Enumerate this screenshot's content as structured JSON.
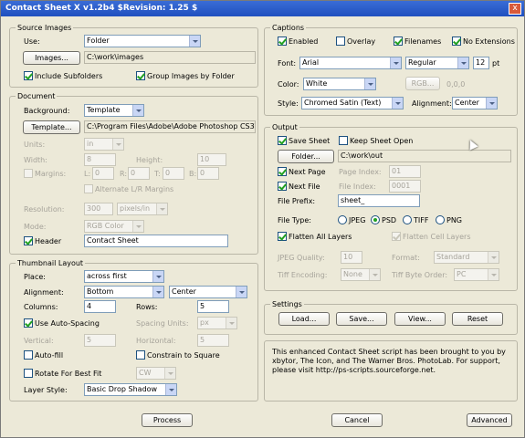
{
  "window": {
    "title": "Contact Sheet X v1.2b4 $Revision: 1.25 $",
    "close_glyph": "x"
  },
  "source": {
    "legend": "Source Images",
    "use_label": "Use:",
    "use_value": "Folder",
    "images_button": "Images...",
    "images_path": "C:\\work\\images",
    "include_subfolders": "Include Subfolders",
    "group_by_folder": "Group Images by Folder"
  },
  "document": {
    "legend": "Document",
    "background_label": "Background:",
    "background_value": "Template",
    "template_button": "Template...",
    "template_path": "C:\\Program Files\\Adobe\\Adobe Photoshop CS3\\Prese",
    "units_label": "Units:",
    "units_value": "in",
    "width_label": "Width:",
    "width_value": "8",
    "height_label": "Height:",
    "height_value": "10",
    "margins_label": "Margins:",
    "l_label": "L:",
    "l_value": "0",
    "r_label": "R:",
    "r_value": "0",
    "t_label": "T:",
    "t_value": "0",
    "b_label": "B:",
    "b_value": "0",
    "alternate_margins": "Alternate L/R Margins",
    "resolution_label": "Resolution:",
    "resolution_value": "300",
    "resolution_unit": "pixels/in",
    "mode_label": "Mode:",
    "mode_value": "RGB Color",
    "header_label": "Header",
    "header_value": "Contact Sheet"
  },
  "thumbnail": {
    "legend": "Thumbnail Layout",
    "place_label": "Place:",
    "place_value": "across first",
    "alignment_label": "Alignment:",
    "alignment_v": "Bottom",
    "alignment_h": "Center",
    "columns_label": "Columns:",
    "columns_value": "4",
    "rows_label": "Rows:",
    "rows_value": "5",
    "auto_spacing": "Use Auto-Spacing",
    "spacing_units_label": "Spacing Units:",
    "spacing_units_value": "px",
    "vertical_label": "Vertical:",
    "vertical_value": "5",
    "horizontal_label": "Horizontal:",
    "horizontal_value": "5",
    "auto_fill": "Auto-fill",
    "constrain_square": "Constrain to Square",
    "rotate_best_fit": "Rotate For Best Fit",
    "rotate_value": "CW",
    "layer_style_label": "Layer Style:",
    "layer_style_value": "Basic Drop Shadow"
  },
  "captions": {
    "legend": "Captions",
    "enabled": "Enabled",
    "overlay": "Overlay",
    "filenames": "Filenames",
    "no_extensions": "No Extensions",
    "font_label": "Font:",
    "font_value": "Arial",
    "font_style": "Regular",
    "font_size": "12",
    "font_unit": "pt",
    "color_label": "Color:",
    "color_value": "White",
    "rgb_button": "RGB...",
    "rgb_value": "0,0,0",
    "style_label": "Style:",
    "style_value": "Chromed Satin (Text)",
    "alignment_label": "Alignment:",
    "alignment_value": "Center"
  },
  "output": {
    "legend": "Output",
    "save_sheet": "Save Sheet",
    "keep_open": "Keep Sheet Open",
    "folder_button": "Folder...",
    "folder_path": "C:\\work\\out",
    "next_page": "Next Page",
    "page_index_label": "Page Index:",
    "page_index_value": "01",
    "next_file": "Next File",
    "file_index_label": "File Index:",
    "file_index_value": "0001",
    "file_prefix_label": "File Prefix:",
    "file_prefix_value": "sheet_",
    "file_type_label": "File Type:",
    "file_types": [
      "JPEG",
      "PSD",
      "TIFF",
      "PNG"
    ],
    "flatten_all": "Flatten All Layers",
    "flatten_cell": "Flatten Cell Layers",
    "jpeg_quality_label": "JPEG Quality:",
    "jpeg_quality_value": "10",
    "format_label": "Format:",
    "format_value": "Standard",
    "tiff_encoding_label": "Tiff Encoding:",
    "tiff_encoding_value": "None",
    "tiff_byte_order_label": "Tiff Byte Order:",
    "tiff_byte_order_value": "PC"
  },
  "settings": {
    "legend": "Settings",
    "load": "Load...",
    "save": "Save...",
    "view": "View...",
    "reset": "Reset"
  },
  "credits": "This enhanced Contact Sheet script has been brought to you by xbytor, The Icon, and The Warner Bros. PhotoLab. For support, please visit http://ps-scripts.sourceforge.net.",
  "footer": {
    "process": "Process",
    "cancel": "Cancel",
    "advanced": "Advanced"
  }
}
